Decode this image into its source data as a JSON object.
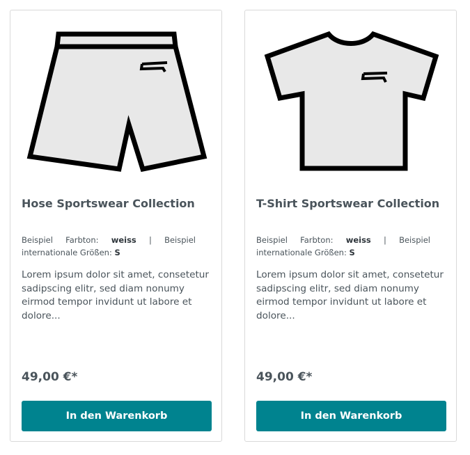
{
  "products": [
    {
      "image_icon": "shorts-icon",
      "title": "Hose Sportswear Collection",
      "prop1_label": "Beispiel",
      "prop1_key": "Farbton:",
      "prop1_value": "weiss",
      "separator": "|",
      "prop2_label": "Beispiel",
      "prop2_key": "internationale Größen:",
      "prop2_value": "S",
      "description": "Lorem ipsum dolor sit amet, consetetur sadipscing elitr, sed diam nonumy eirmod tempor invidunt ut labore et dolore...",
      "price": "49,00 €*",
      "button_label": "In den Warenkorb"
    },
    {
      "image_icon": "tshirt-icon",
      "title": "T-Shirt Sportswear Collection",
      "prop1_label": "Beispiel",
      "prop1_key": "Farbton:",
      "prop1_value": "weiss",
      "separator": "|",
      "prop2_label": "Beispiel",
      "prop2_key": "internationale Größen:",
      "prop2_value": "S",
      "description": "Lorem ipsum dolor sit amet, consetetur sadipscing elitr, sed diam nonumy eirmod tempor invidunt ut labore et dolore...",
      "price": "49,00 €*",
      "button_label": "In den Warenkorb"
    }
  ],
  "colors": {
    "button": "#00838f",
    "text": "#4a545b",
    "garment_fill": "#e8e8e8",
    "garment_stroke": "#000000"
  }
}
